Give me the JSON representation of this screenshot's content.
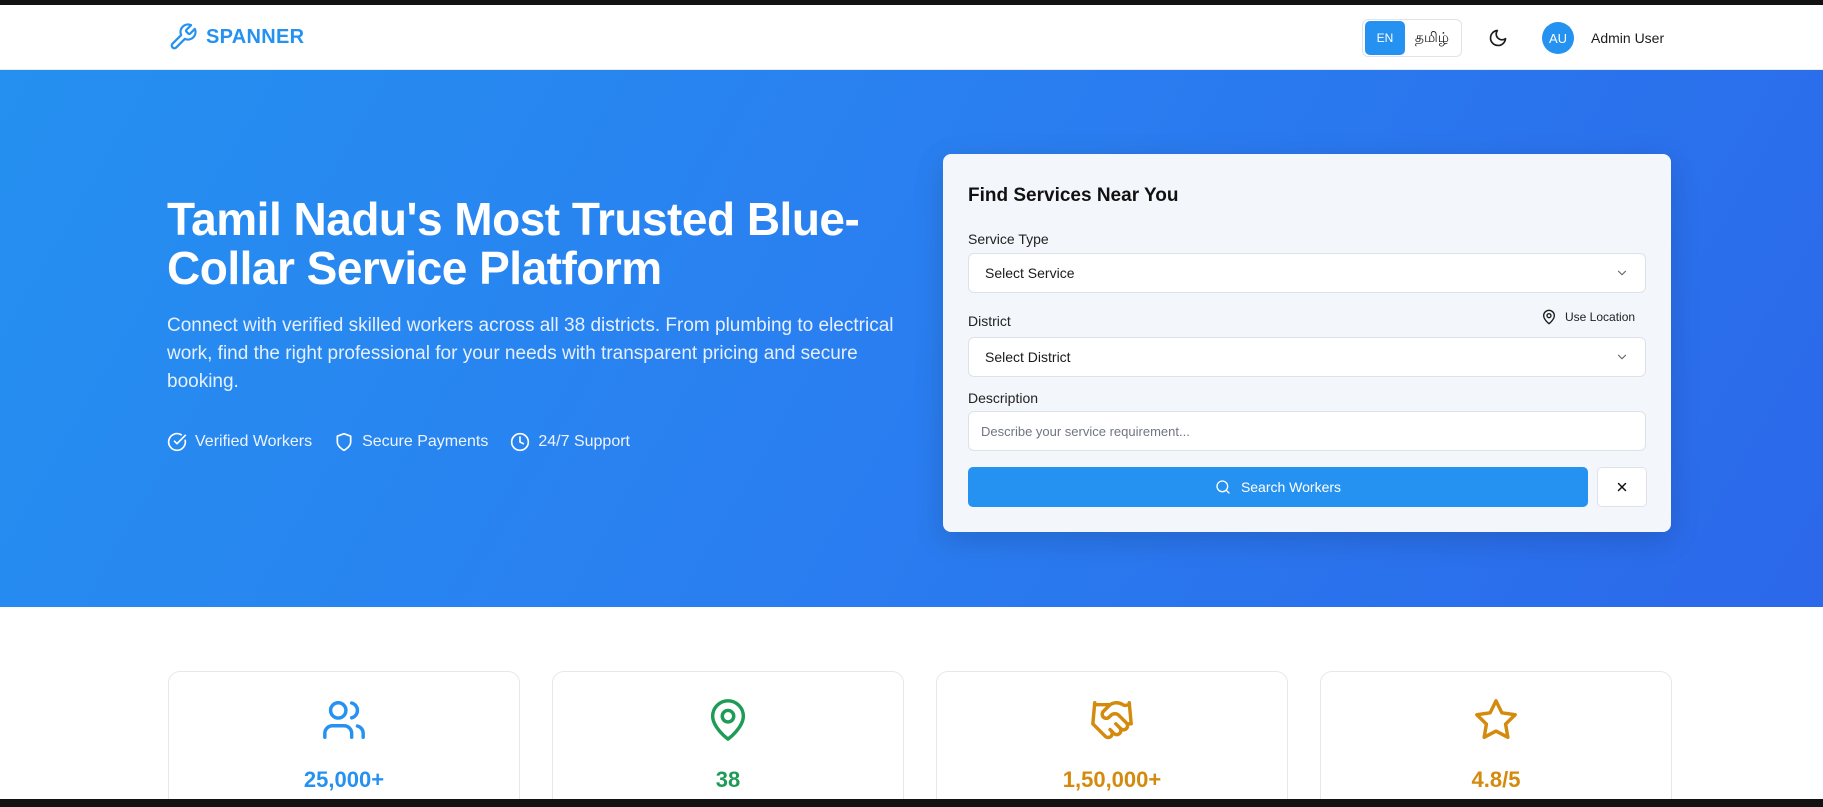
{
  "header": {
    "logo_text": "SPANNER",
    "lang_en": "EN",
    "lang_ta": "தமிழ்",
    "avatar_initials": "AU",
    "user_name": "Admin User"
  },
  "hero": {
    "title": "Tamil Nadu's Most Trusted Blue-Collar Service Platform",
    "subtitle": "Connect with verified skilled workers across all 38 districts. From plumbing to electrical work, find the right professional for your needs with transparent pricing and secure booking.",
    "features": [
      "Verified Workers",
      "Secure Payments",
      "24/7 Support"
    ]
  },
  "search": {
    "title": "Find Services Near You",
    "service_label": "Service Type",
    "service_value": "Select Service",
    "district_label": "District",
    "use_location": "Use Location",
    "district_value": "Select District",
    "description_label": "Description",
    "description_placeholder": "Describe your service requirement...",
    "search_button": "Search Workers"
  },
  "stats": [
    {
      "value": "25,000+",
      "icon": "users-icon",
      "color": "#2591f0"
    },
    {
      "value": "38",
      "icon": "map-pin-icon",
      "color": "#1e9b57"
    },
    {
      "value": "1,50,000+",
      "icon": "handshake-icon",
      "color": "#d48a0c"
    },
    {
      "value": "4.8/5",
      "icon": "star-icon",
      "color": "#d48a0c"
    }
  ],
  "colors": {
    "primary": "#2591f0",
    "hero_gradient_end": "#2b68ea"
  }
}
